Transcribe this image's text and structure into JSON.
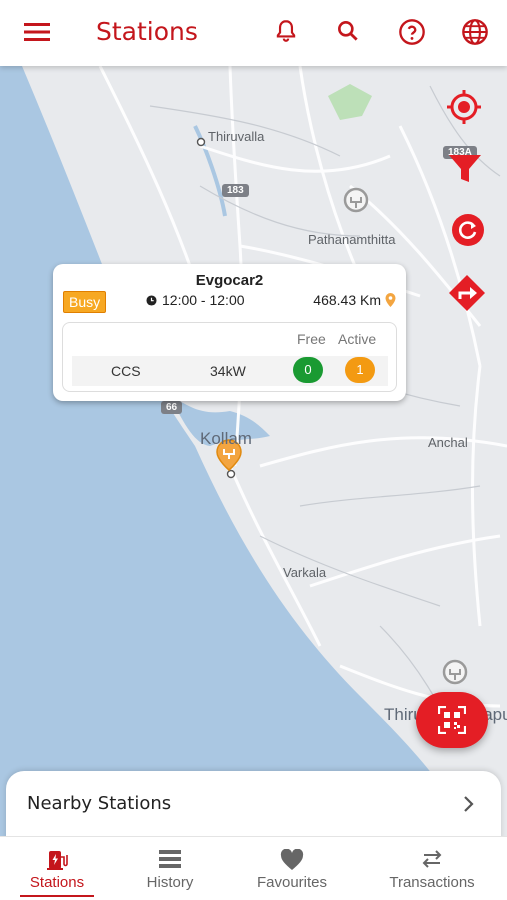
{
  "appbar": {
    "title": "Stations",
    "icons": [
      "menu-icon",
      "bell-icon",
      "search-icon",
      "help-icon",
      "globe-icon"
    ]
  },
  "colors": {
    "brand": "#c4161c",
    "fab": "#e41e25",
    "busy": "#f7a823",
    "free": "#1a9a32",
    "active": "#f39a12"
  },
  "map": {
    "labels": {
      "thiruvalla": "Thiruvalla",
      "pathanamthitta": "Pathanamthitta",
      "kollam": "Kollam",
      "anchal": "Anchal",
      "varkala": "Varkala",
      "thiruvananthapuram": "Thiruvananthapuram"
    },
    "shields": {
      "r183": "183",
      "r66": "66",
      "r183a": "183A"
    }
  },
  "station_card": {
    "name": "Evgocar2",
    "status": "Busy",
    "hours": "12:00 - 12:00",
    "distance": "468.43 Km",
    "header_free": "Free",
    "header_active": "Active",
    "connector": {
      "type": "CCS",
      "power": "34kW",
      "free": "0",
      "active": "1"
    }
  },
  "nearby": {
    "label": "Nearby Stations"
  },
  "bottom_nav": {
    "items": [
      {
        "label": "Stations",
        "icon": "charging-station-icon",
        "active": true
      },
      {
        "label": "History",
        "icon": "history-icon",
        "active": false
      },
      {
        "label": "Favourites",
        "icon": "heart-icon",
        "active": false
      },
      {
        "label": "Transactions",
        "icon": "transfer-icon",
        "active": false
      }
    ]
  }
}
